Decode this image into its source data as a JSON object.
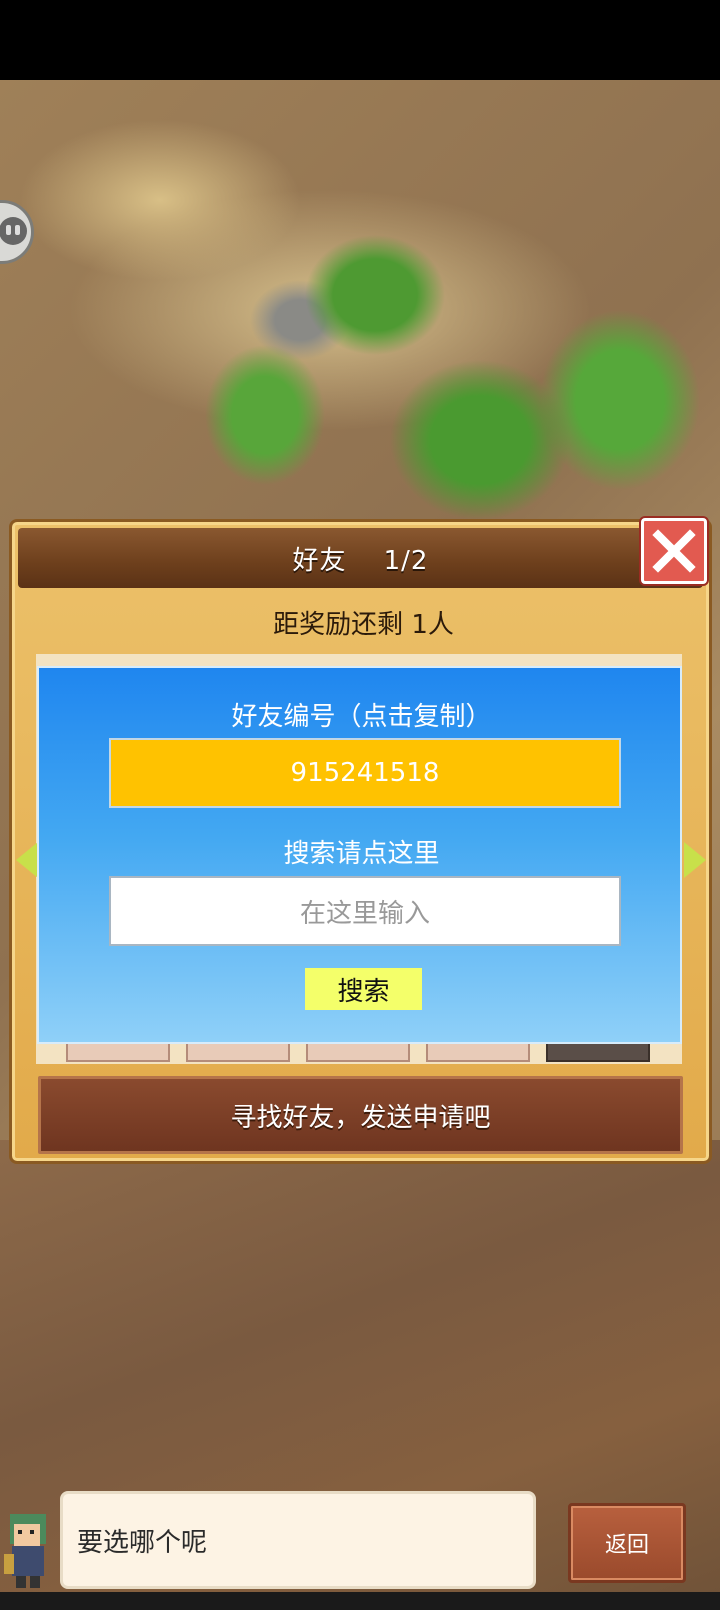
{
  "dialog": {
    "title": "好友    1/2",
    "reward_remaining": "距奖励还剩 1人",
    "find_friends_button": "寻找好友，发送申请吧"
  },
  "friend_panel": {
    "id_label": "好友编号（点击复制）",
    "friend_id": "915241518",
    "search_label": "搜索请点这里",
    "search_placeholder": "在这里输入",
    "search_button": "搜索"
  },
  "bottom": {
    "speech_text": "要选哪个呢",
    "back_button": "返回"
  },
  "colors": {
    "friend_id_bg": "#ffc200",
    "panel_top": "#1f86ef",
    "close_button": "#e25a50",
    "search_button": "#f4ff6a"
  },
  "icons": {
    "close": "close-icon",
    "emoji": "emoji-face-icon",
    "arrow_left": "arrow-left-icon",
    "arrow_right": "arrow-right-icon"
  }
}
